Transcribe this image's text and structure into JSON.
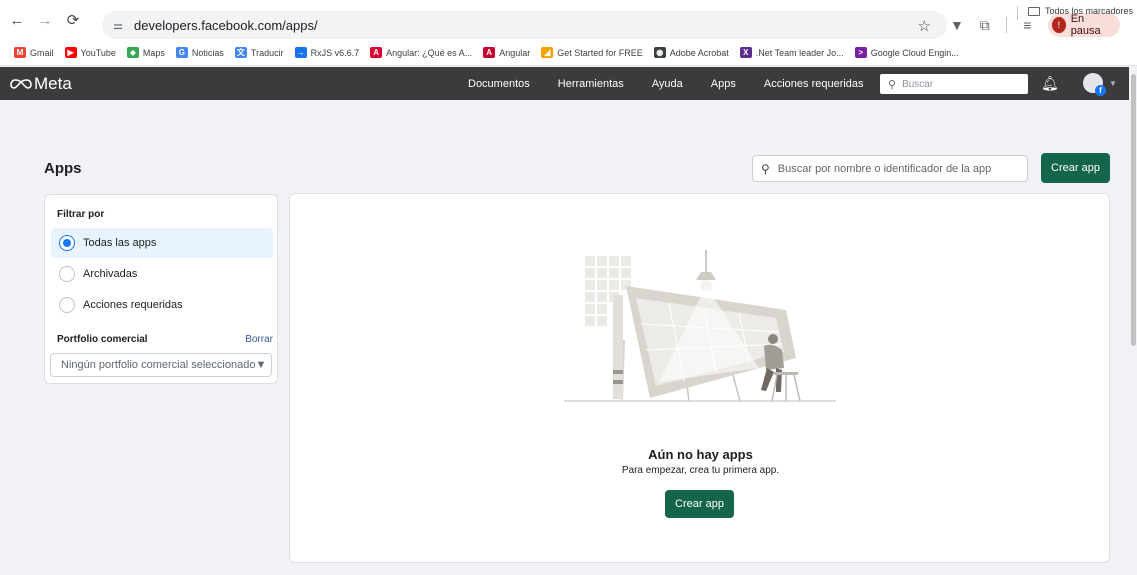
{
  "browser": {
    "url": "developers.facebook.com/apps/",
    "profile_label": "En pausa",
    "profile_initial": "!"
  },
  "bookmarks": [
    {
      "label": "Gmail",
      "color": "#ea4335",
      "glyph": "M"
    },
    {
      "label": "YouTube",
      "color": "#ff0000",
      "glyph": "▶"
    },
    {
      "label": "Maps",
      "color": "#34a853",
      "glyph": "⬥"
    },
    {
      "label": "Noticias",
      "color": "#4285f4",
      "glyph": "G"
    },
    {
      "label": "Traducir",
      "color": "#4285f4",
      "glyph": "文"
    },
    {
      "label": "RxJS v6.6.7",
      "color": "#1a73e8",
      "glyph": "→"
    },
    {
      "label": "Angular: ¿Qué es A...",
      "color": "#dd0031",
      "glyph": "A"
    },
    {
      "label": "Angular",
      "color": "#c3002f",
      "glyph": "A"
    },
    {
      "label": "Get Started for FREE",
      "color": "#f4a100",
      "glyph": "◢"
    },
    {
      "label": "Adobe Acrobat",
      "color": "#3c4043",
      "glyph": "◉"
    },
    {
      "label": ".Net Team leader Jo...",
      "color": "#5c2d91",
      "glyph": "X"
    },
    {
      "label": "Google Cloud Engin...",
      "color": "#7b1fa2",
      "glyph": ">"
    }
  ],
  "bookmarks_right": "Todos los marcadores",
  "meta_nav": {
    "logo_text": "Meta",
    "links": [
      "Documentos",
      "Herramientas",
      "Ayuda",
      "Apps",
      "Acciones requeridas"
    ],
    "search_placeholder": "Buscar"
  },
  "page": {
    "title": "Apps",
    "search_placeholder": "Buscar por nombre o identificador de la app",
    "create_label": "Crear app"
  },
  "filter": {
    "title": "Filtrar por",
    "options": [
      {
        "label": "Todas las apps",
        "checked": true
      },
      {
        "label": "Archivadas",
        "checked": false
      },
      {
        "label": "Acciones requeridas",
        "checked": false
      }
    ],
    "portfolio_title": "Portfolio comercial",
    "portfolio_clear": "Borrar",
    "portfolio_selected": "Ningún portfolio comercial seleccionado"
  },
  "empty_state": {
    "title": "Aún no hay apps",
    "subtitle": "Para empezar, crea tu primera app.",
    "button_label": "Crear app"
  },
  "colors": {
    "accent_green": "#14654c",
    "meta_nav_bg": "#3a3b3c",
    "selection_blue": "#1877f2"
  }
}
